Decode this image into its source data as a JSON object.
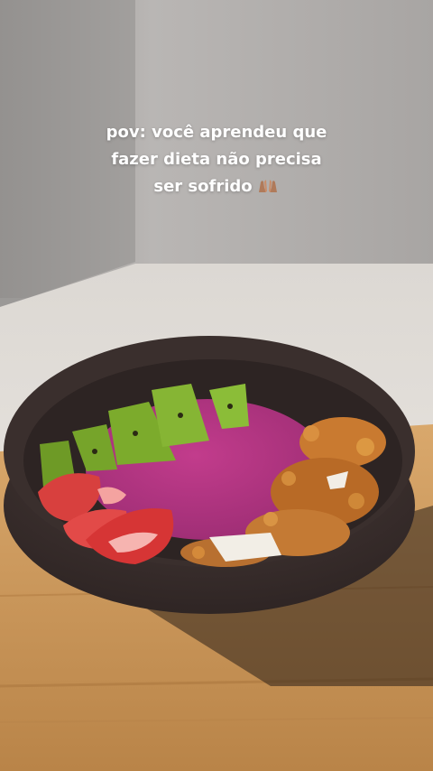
{
  "caption": {
    "line1": "pov: você aprendeu que",
    "line2": "fazer dieta não precisa",
    "line3": "ser sofrido",
    "emoji": "praying-hands-icon"
  },
  "colors": {
    "wall": "#a9a6a4",
    "table": "#e7e2dc",
    "wood": "#c8955c",
    "bowl": "#3c302e",
    "acai": "#b0337f",
    "kiwi": "#7cab2c",
    "strawberry": "#d93a3a",
    "granola": "#c97a30"
  }
}
